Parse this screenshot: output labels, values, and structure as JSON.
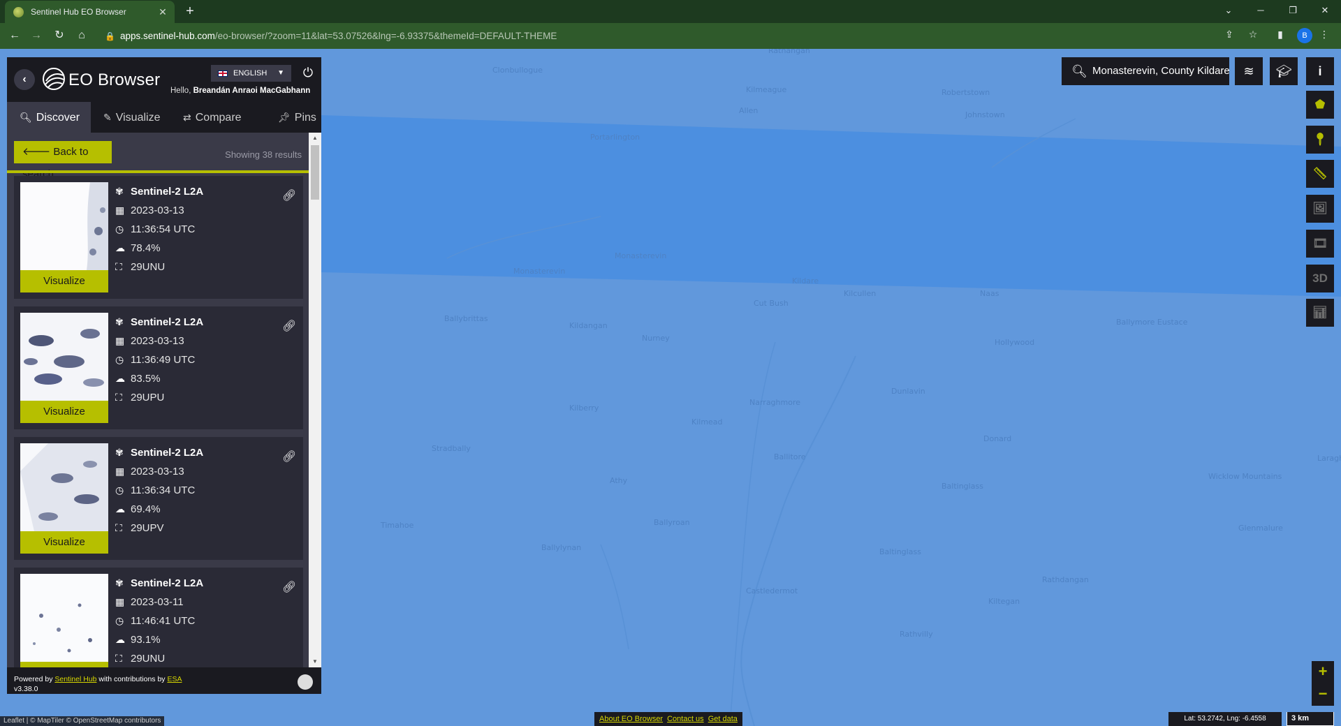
{
  "browser": {
    "tab_title": "Sentinel Hub EO Browser",
    "url_host": "apps.sentinel-hub.com",
    "url_rest": "/eo-browser/?zoom=11&lat=53.07526&lng=-6.93375&themeId=DEFAULT-THEME",
    "profile_initial": "B"
  },
  "panel": {
    "app_title": "EO Browser",
    "language": "ENGLISH",
    "greeting_prefix": "Hello, ",
    "user_name": "Breandán Anraoi MacGabhann",
    "tabs": [
      {
        "label": "Discover",
        "icon": "search-icon"
      },
      {
        "label": "Visualize",
        "icon": "brush-icon"
      },
      {
        "label": "Compare",
        "icon": "swap-icon"
      },
      {
        "label": "Pins",
        "icon": "pin-icon"
      }
    ],
    "back_to_search": "Back to search",
    "showing_results": "Showing 38 results",
    "visualize_label": "Visualize",
    "results": [
      {
        "dataset": "Sentinel-2 L2A",
        "date": "2023-03-13",
        "time": "11:36:54 UTC",
        "cloud": "78.4%",
        "tile": "29UNU"
      },
      {
        "dataset": "Sentinel-2 L2A",
        "date": "2023-03-13",
        "time": "11:36:49 UTC",
        "cloud": "83.5%",
        "tile": "29UPU"
      },
      {
        "dataset": "Sentinel-2 L2A",
        "date": "2023-03-13",
        "time": "11:36:34 UTC",
        "cloud": "69.4%",
        "tile": "29UPV"
      },
      {
        "dataset": "Sentinel-2 L2A",
        "date": "2023-03-11",
        "time": "11:46:41 UTC",
        "cloud": "93.1%",
        "tile": "29UNU"
      }
    ],
    "footer": {
      "powered_by": "Powered by ",
      "sentinel_hub": "Sentinel Hub",
      "contrib": " with contributions by ",
      "esa": "ESA",
      "version": "v3.38.0"
    }
  },
  "map": {
    "search_value": "Monasterevin, County Kildare",
    "zoom_in": "+",
    "zoom_out": "−",
    "tool_3d": "3D",
    "attribution": "Leaflet | © MapTiler © OpenStreetMap contributors",
    "links": [
      "About EO Browser",
      "Contact us",
      "Get data"
    ],
    "coordinates": "Lat: 53.2742, Lng: -6.4558",
    "scale": "3 km",
    "colors": {
      "map": "#6198dc",
      "swath": "#4a8ee0",
      "accent": "#b6bf00"
    }
  }
}
